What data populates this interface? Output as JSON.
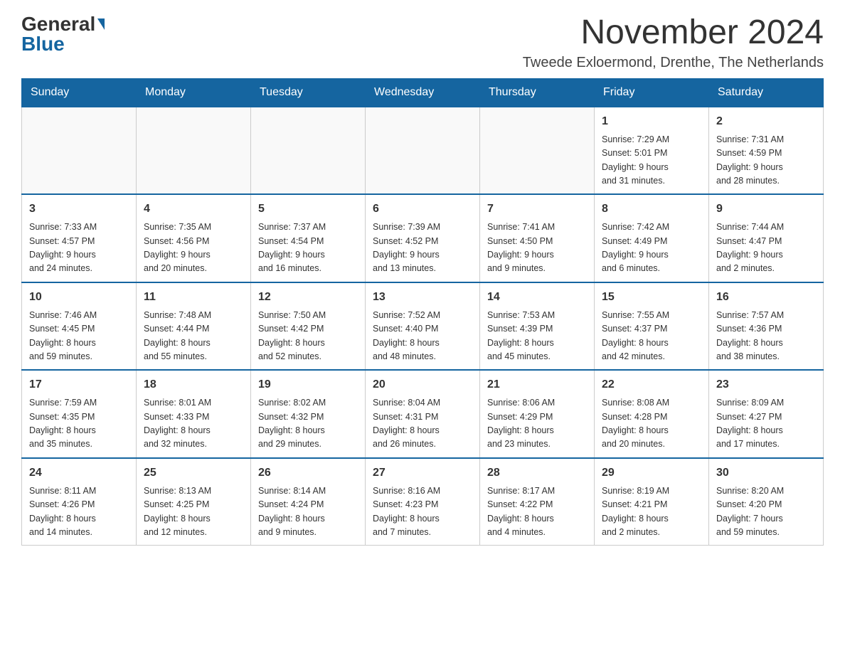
{
  "header": {
    "logo_general": "General",
    "logo_blue": "Blue",
    "month_title": "November 2024",
    "subtitle": "Tweede Exloermond, Drenthe, The Netherlands"
  },
  "weekdays": [
    "Sunday",
    "Monday",
    "Tuesday",
    "Wednesday",
    "Thursday",
    "Friday",
    "Saturday"
  ],
  "weeks": [
    [
      {
        "day": "",
        "info": ""
      },
      {
        "day": "",
        "info": ""
      },
      {
        "day": "",
        "info": ""
      },
      {
        "day": "",
        "info": ""
      },
      {
        "day": "",
        "info": ""
      },
      {
        "day": "1",
        "info": "Sunrise: 7:29 AM\nSunset: 5:01 PM\nDaylight: 9 hours\nand 31 minutes."
      },
      {
        "day": "2",
        "info": "Sunrise: 7:31 AM\nSunset: 4:59 PM\nDaylight: 9 hours\nand 28 minutes."
      }
    ],
    [
      {
        "day": "3",
        "info": "Sunrise: 7:33 AM\nSunset: 4:57 PM\nDaylight: 9 hours\nand 24 minutes."
      },
      {
        "day": "4",
        "info": "Sunrise: 7:35 AM\nSunset: 4:56 PM\nDaylight: 9 hours\nand 20 minutes."
      },
      {
        "day": "5",
        "info": "Sunrise: 7:37 AM\nSunset: 4:54 PM\nDaylight: 9 hours\nand 16 minutes."
      },
      {
        "day": "6",
        "info": "Sunrise: 7:39 AM\nSunset: 4:52 PM\nDaylight: 9 hours\nand 13 minutes."
      },
      {
        "day": "7",
        "info": "Sunrise: 7:41 AM\nSunset: 4:50 PM\nDaylight: 9 hours\nand 9 minutes."
      },
      {
        "day": "8",
        "info": "Sunrise: 7:42 AM\nSunset: 4:49 PM\nDaylight: 9 hours\nand 6 minutes."
      },
      {
        "day": "9",
        "info": "Sunrise: 7:44 AM\nSunset: 4:47 PM\nDaylight: 9 hours\nand 2 minutes."
      }
    ],
    [
      {
        "day": "10",
        "info": "Sunrise: 7:46 AM\nSunset: 4:45 PM\nDaylight: 8 hours\nand 59 minutes."
      },
      {
        "day": "11",
        "info": "Sunrise: 7:48 AM\nSunset: 4:44 PM\nDaylight: 8 hours\nand 55 minutes."
      },
      {
        "day": "12",
        "info": "Sunrise: 7:50 AM\nSunset: 4:42 PM\nDaylight: 8 hours\nand 52 minutes."
      },
      {
        "day": "13",
        "info": "Sunrise: 7:52 AM\nSunset: 4:40 PM\nDaylight: 8 hours\nand 48 minutes."
      },
      {
        "day": "14",
        "info": "Sunrise: 7:53 AM\nSunset: 4:39 PM\nDaylight: 8 hours\nand 45 minutes."
      },
      {
        "day": "15",
        "info": "Sunrise: 7:55 AM\nSunset: 4:37 PM\nDaylight: 8 hours\nand 42 minutes."
      },
      {
        "day": "16",
        "info": "Sunrise: 7:57 AM\nSunset: 4:36 PM\nDaylight: 8 hours\nand 38 minutes."
      }
    ],
    [
      {
        "day": "17",
        "info": "Sunrise: 7:59 AM\nSunset: 4:35 PM\nDaylight: 8 hours\nand 35 minutes."
      },
      {
        "day": "18",
        "info": "Sunrise: 8:01 AM\nSunset: 4:33 PM\nDaylight: 8 hours\nand 32 minutes."
      },
      {
        "day": "19",
        "info": "Sunrise: 8:02 AM\nSunset: 4:32 PM\nDaylight: 8 hours\nand 29 minutes."
      },
      {
        "day": "20",
        "info": "Sunrise: 8:04 AM\nSunset: 4:31 PM\nDaylight: 8 hours\nand 26 minutes."
      },
      {
        "day": "21",
        "info": "Sunrise: 8:06 AM\nSunset: 4:29 PM\nDaylight: 8 hours\nand 23 minutes."
      },
      {
        "day": "22",
        "info": "Sunrise: 8:08 AM\nSunset: 4:28 PM\nDaylight: 8 hours\nand 20 minutes."
      },
      {
        "day": "23",
        "info": "Sunrise: 8:09 AM\nSunset: 4:27 PM\nDaylight: 8 hours\nand 17 minutes."
      }
    ],
    [
      {
        "day": "24",
        "info": "Sunrise: 8:11 AM\nSunset: 4:26 PM\nDaylight: 8 hours\nand 14 minutes."
      },
      {
        "day": "25",
        "info": "Sunrise: 8:13 AM\nSunset: 4:25 PM\nDaylight: 8 hours\nand 12 minutes."
      },
      {
        "day": "26",
        "info": "Sunrise: 8:14 AM\nSunset: 4:24 PM\nDaylight: 8 hours\nand 9 minutes."
      },
      {
        "day": "27",
        "info": "Sunrise: 8:16 AM\nSunset: 4:23 PM\nDaylight: 8 hours\nand 7 minutes."
      },
      {
        "day": "28",
        "info": "Sunrise: 8:17 AM\nSunset: 4:22 PM\nDaylight: 8 hours\nand 4 minutes."
      },
      {
        "day": "29",
        "info": "Sunrise: 8:19 AM\nSunset: 4:21 PM\nDaylight: 8 hours\nand 2 minutes."
      },
      {
        "day": "30",
        "info": "Sunrise: 8:20 AM\nSunset: 4:20 PM\nDaylight: 7 hours\nand 59 minutes."
      }
    ]
  ]
}
